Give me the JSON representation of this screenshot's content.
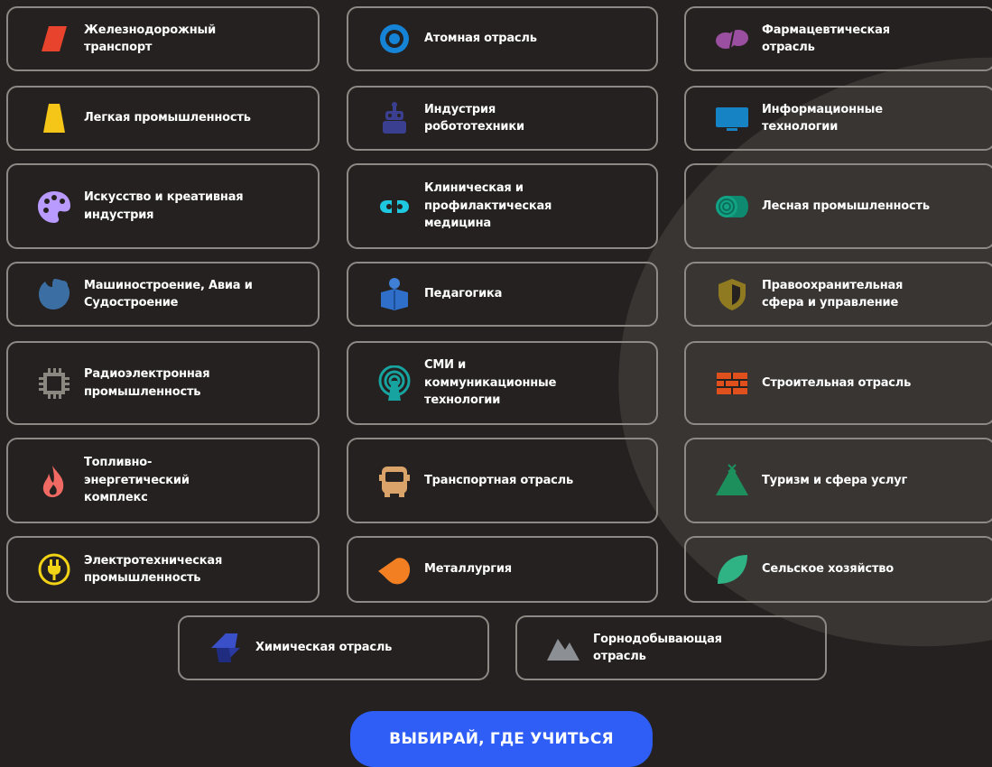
{
  "cards": [
    {
      "label": "Железнодорожный\nтранспорт",
      "icon": "railway-icon"
    },
    {
      "label": "Атомная отрасль",
      "icon": "atom-icon"
    },
    {
      "label": "Фармацевтическая\nотрасль",
      "icon": "pill-icon"
    },
    {
      "label": "Легкая промышленность",
      "icon": "dress-icon"
    },
    {
      "label": "Индустрия\nробототехники",
      "icon": "robot-icon"
    },
    {
      "label": "Информационные\nтехнологии",
      "icon": "monitor-icon"
    },
    {
      "label": "Искусство и креативная\nиндустрия",
      "icon": "palette-icon"
    },
    {
      "label": "Клиническая и\nпрофилактическая\nмедицина",
      "icon": "capsule-icon"
    },
    {
      "label": "Лесная промышленность",
      "icon": "log-icon"
    },
    {
      "label": "Машиностроение, Авиа и\nСудостроение",
      "icon": "gear-icon"
    },
    {
      "label": "Педагогика",
      "icon": "teacher-icon"
    },
    {
      "label": "Правоохранительная\nсфера и управление",
      "icon": "shield-icon"
    },
    {
      "label": "Радиоэлектронная\nпромышленность",
      "icon": "chip-icon"
    },
    {
      "label": "СМИ и\nкоммуникационные\nтехнологии",
      "icon": "antenna-icon"
    },
    {
      "label": "Строительная отрасль",
      "icon": "brick-icon"
    },
    {
      "label": "Топливно-\nэнергетический\nкомплекс",
      "icon": "flame-icon"
    },
    {
      "label": "Транспортная отрасль",
      "icon": "bus-icon"
    },
    {
      "label": "Туризм и сфера услуг",
      "icon": "tent-icon"
    },
    {
      "label": "Электротехническая\nпромышленность",
      "icon": "plug-icon"
    },
    {
      "label": "Металлургия",
      "icon": "metal-drop-icon"
    },
    {
      "label": "Сельское хозяйство",
      "icon": "leaf-icon"
    },
    {
      "label": "Химическая отрасль",
      "icon": "chemistry-icon"
    },
    {
      "label": "Горнодобывающая\nотрасль",
      "icon": "mountain-icon"
    }
  ],
  "cta": {
    "label": "ВЫБИРАЙ, ГДЕ УЧИТЬСЯ"
  },
  "colors": {
    "background": "#252120",
    "card_border": "#8d8a86",
    "cta": "#2f5ef7"
  }
}
